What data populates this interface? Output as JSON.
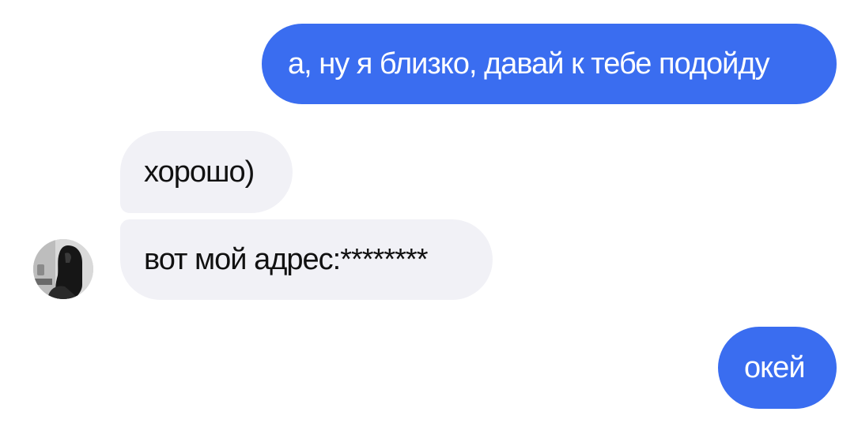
{
  "conversation": {
    "messages": [
      {
        "sender": "me",
        "text": "а, ну я близко, давай к тебе подойду"
      },
      {
        "sender": "contact",
        "text": "хорошо)"
      },
      {
        "sender": "contact",
        "text": "вот мой адрес:********"
      },
      {
        "sender": "me",
        "text": "окей"
      }
    ]
  },
  "contact": {
    "avatar_icon": "contact-avatar-photo"
  },
  "colors": {
    "outgoing_bubble": "#3a6df0",
    "incoming_bubble": "#f1f1f6",
    "background": "#ffffff"
  }
}
